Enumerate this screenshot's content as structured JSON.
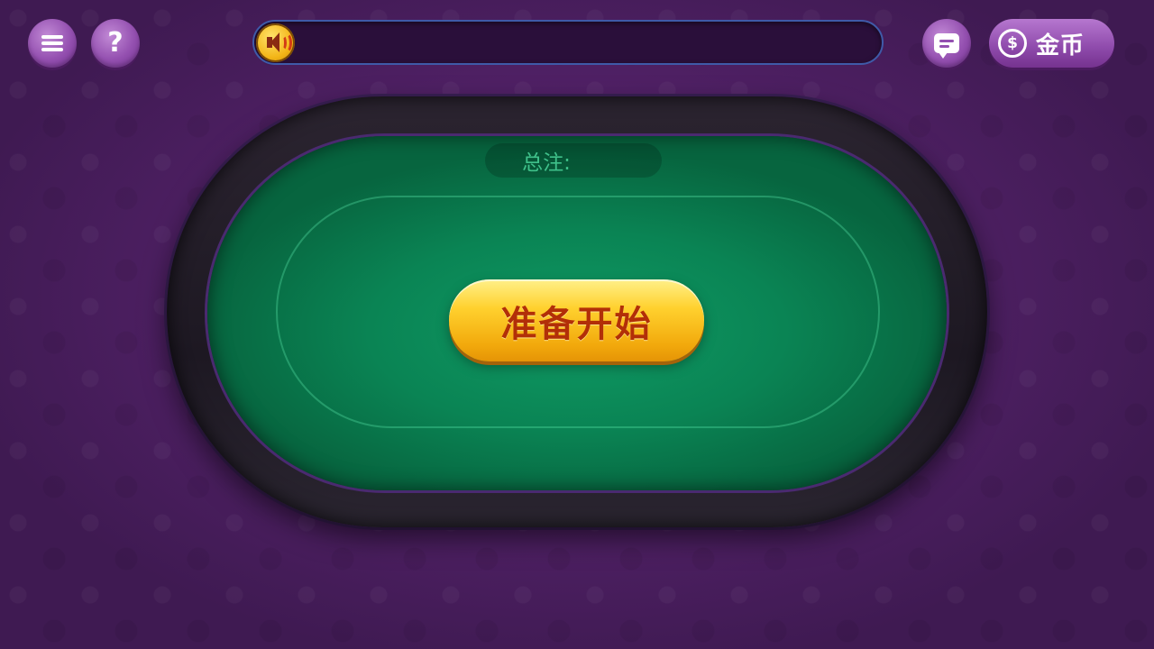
{
  "top_bar": {
    "menu_icon": "menu-icon",
    "help_icon": "help-icon",
    "help_glyph": "?",
    "notice": {
      "icon": "speaker-icon",
      "text": ""
    },
    "chat_icon": "chat-icon",
    "coin": {
      "icon": "dollar-coin-icon",
      "icon_glyph": "$",
      "label": "金币"
    }
  },
  "table": {
    "total_bet_label": "总注:",
    "total_bet_value": "",
    "ready_button_label": "准备开始"
  },
  "colors": {
    "background": "#54226a",
    "felt": "#0a8454",
    "ready_button": "#ffd12e",
    "ready_text": "#b22f08"
  }
}
